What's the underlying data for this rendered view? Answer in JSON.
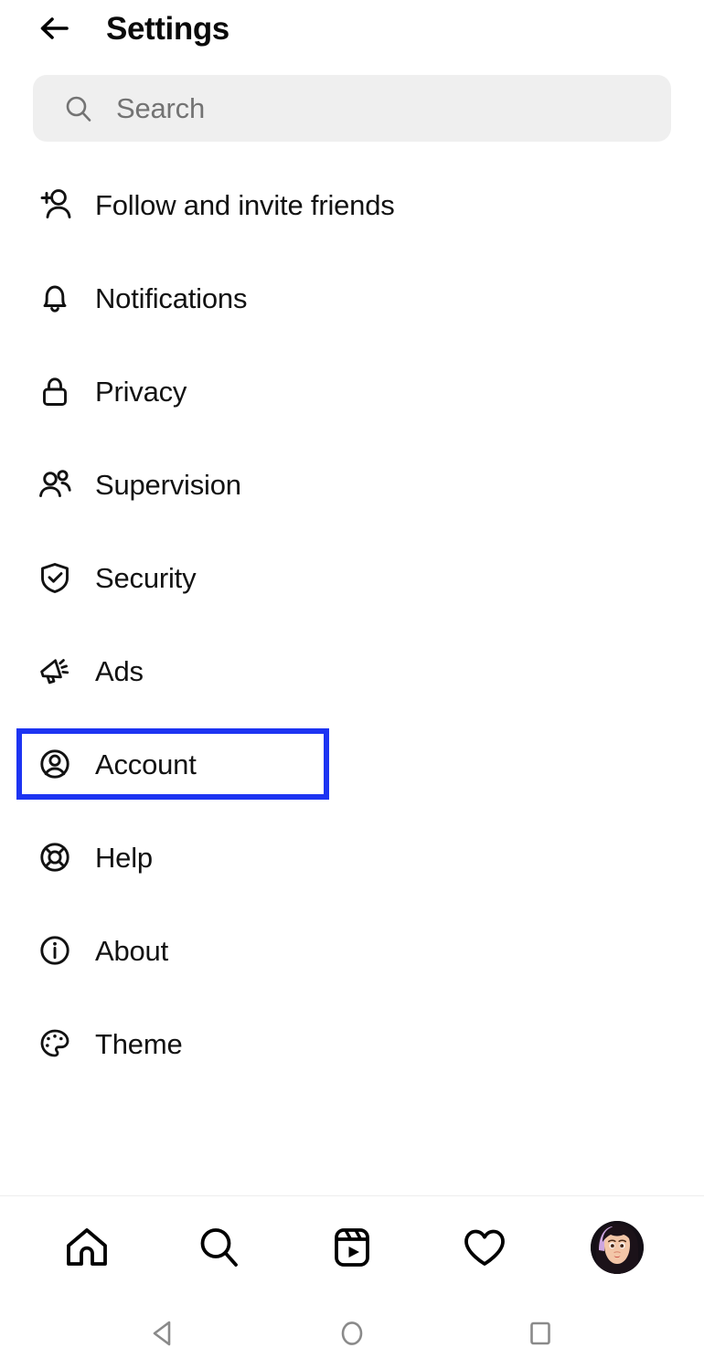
{
  "header": {
    "back_icon": "arrow-left-icon",
    "title": "Settings"
  },
  "search": {
    "icon": "search-icon",
    "placeholder": "Search",
    "value": "",
    "background_color": "#efefef"
  },
  "settings_list": {
    "items": [
      {
        "id": "follow-and-invite-friends",
        "label": "Follow and invite friends",
        "icon": "person-add-icon",
        "highlighted": false
      },
      {
        "id": "notifications",
        "label": "Notifications",
        "icon": "bell-icon",
        "highlighted": false
      },
      {
        "id": "privacy",
        "label": "Privacy",
        "icon": "lock-icon",
        "highlighted": false
      },
      {
        "id": "supervision",
        "label": "Supervision",
        "icon": "people-icon",
        "highlighted": false
      },
      {
        "id": "security",
        "label": "Security",
        "icon": "shield-check-icon",
        "highlighted": false
      },
      {
        "id": "ads",
        "label": "Ads",
        "icon": "megaphone-icon",
        "highlighted": false
      },
      {
        "id": "account",
        "label": "Account",
        "icon": "account-circle-icon",
        "highlighted": true
      },
      {
        "id": "help",
        "label": "Help",
        "icon": "life-ring-icon",
        "highlighted": false
      },
      {
        "id": "about",
        "label": "About",
        "icon": "info-circle-icon",
        "highlighted": false
      },
      {
        "id": "theme",
        "label": "Theme",
        "icon": "palette-icon",
        "highlighted": false
      }
    ],
    "highlight_color": "#1d34f2"
  },
  "bottom_nav": {
    "items": [
      {
        "id": "home",
        "icon": "home-icon"
      },
      {
        "id": "search",
        "icon": "search-icon"
      },
      {
        "id": "reels",
        "icon": "reels-icon"
      },
      {
        "id": "activity",
        "icon": "heart-icon"
      },
      {
        "id": "profile",
        "icon": "avatar-icon"
      }
    ]
  },
  "system_nav": {
    "items": [
      {
        "id": "back",
        "icon": "triangle-back-icon"
      },
      {
        "id": "home",
        "icon": "circle-home-icon"
      },
      {
        "id": "recents",
        "icon": "square-recents-icon"
      }
    ],
    "color": "#8a8a8a"
  }
}
